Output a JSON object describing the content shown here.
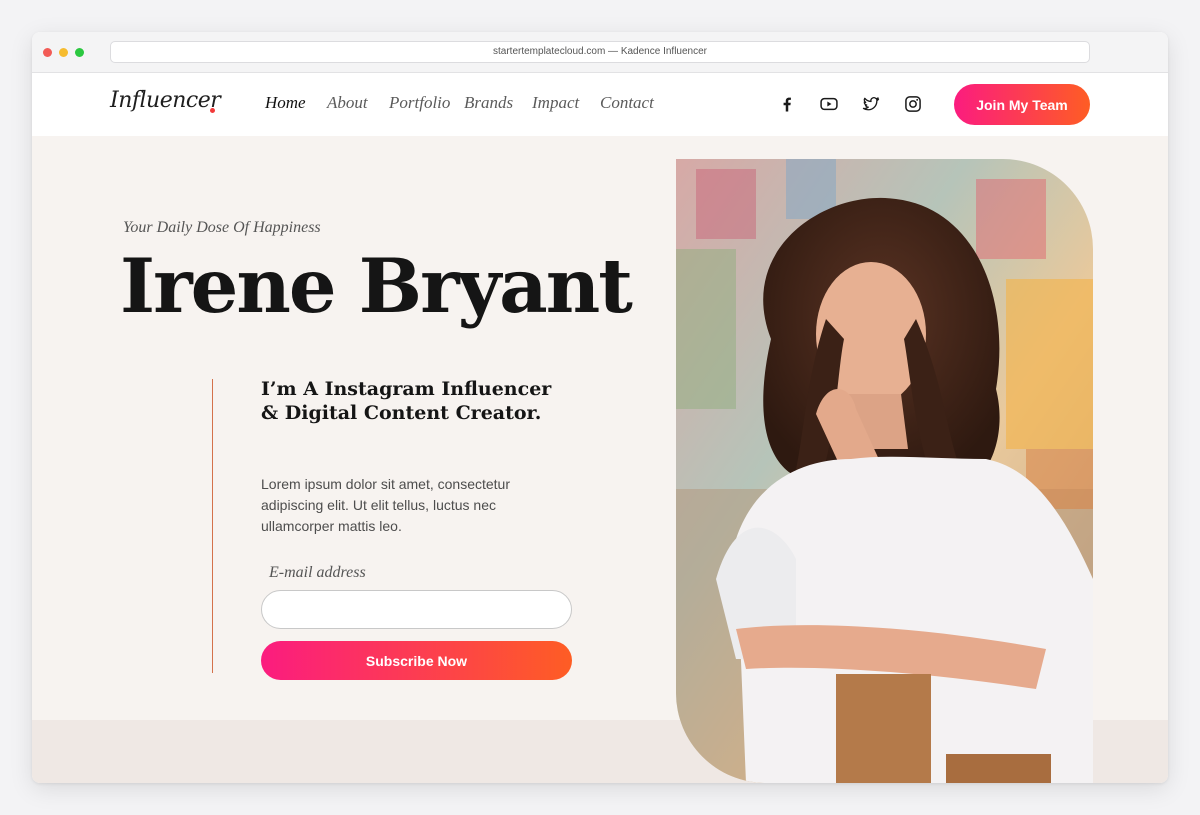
{
  "browser": {
    "url_title": "startertemplatecloud.com — Kadence Influencer"
  },
  "header": {
    "logo": "Influencer",
    "nav": [
      {
        "label": "Home",
        "active": true
      },
      {
        "label": "About"
      },
      {
        "label": "Portfolio"
      },
      {
        "label": "Brands"
      },
      {
        "label": "Impact"
      },
      {
        "label": "Contact"
      }
    ],
    "social_icons": [
      "facebook-icon",
      "youtube-icon",
      "twitter-icon",
      "instagram-icon"
    ],
    "cta_label": "Join My Team"
  },
  "hero": {
    "tagline": "Your Daily Dose Of Happiness",
    "name": "Irene Bryant",
    "subheading": "I’m A Instagram Influencer & Digital Content Creator.",
    "body": "Lorem ipsum dolor sit amet, consectetur adipiscing elit. Ut elit tellus, luctus nec ullamcorper mattis leo.",
    "email_label": "E-mail address",
    "email_value": "",
    "subscribe_label": "Subscribe Now"
  },
  "colors": {
    "gradient_start": "#fb1c7f",
    "gradient_end": "#fe5d24",
    "accent_line": "#d4714b",
    "hero_bg": "#f7f3f0"
  }
}
